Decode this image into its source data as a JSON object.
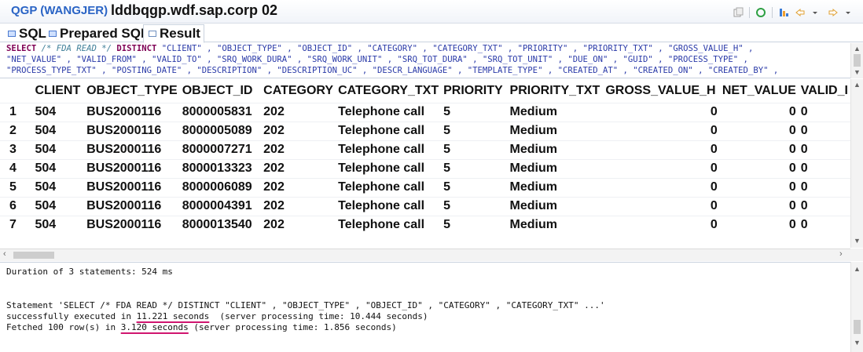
{
  "titlebar": {
    "connection": "QGP (WANGJER)",
    "host": "lddbqgp.wdf.sap.corp 02"
  },
  "tabs": [
    {
      "label": "SQL"
    },
    {
      "label": "Prepared SQL"
    },
    {
      "label": "Result"
    }
  ],
  "sql": {
    "line1_kw1": "SELECT",
    "line1_comment": "/* FDA READ */",
    "line1_kw2": "DISTINCT",
    "line1_rest": "\"CLIENT\" , \"OBJECT_TYPE\" , \"OBJECT_ID\" , \"CATEGORY\" , \"CATEGORY_TXT\" , \"PRIORITY\" , \"PRIORITY_TXT\" , \"GROSS_VALUE_H\" ,",
    "line2": "\"NET_VALUE\" , \"VALID_FROM\" , \"VALID_TO\" , \"SRQ_WORK_DURA\" , \"SRQ_WORK_UNIT\" , \"SRQ_TOT_DURA\" , \"SRQ_TOT_UNIT\" , \"DUE_ON\" , \"GUID\" , \"PROCESS_TYPE\" ,",
    "line3": "\"PROCESS_TYPE_TXT\" , \"POSTING_DATE\" , \"DESCRIPTION\" , \"DESCRIPTION_UC\" , \"DESCR_LANGUAGE\" , \"TEMPLATE_TYPE\" , \"CREATED_AT\" , \"CREATED_ON\" , \"CREATED_BY\" ,"
  },
  "grid": {
    "columns": [
      "",
      "CLIENT",
      "OBJECT_TYPE",
      "OBJECT_ID",
      "CATEGORY",
      "CATEGORY_TXT",
      "PRIORITY",
      "PRIORITY_TXT",
      "GROSS_VALUE_H",
      "NET_VALUE",
      "VALID_I"
    ],
    "rows": [
      [
        "1",
        "504",
        "BUS2000116",
        "8000005831",
        "202",
        "Telephone call",
        "5",
        "Medium",
        "0",
        "0",
        "0"
      ],
      [
        "2",
        "504",
        "BUS2000116",
        "8000005089",
        "202",
        "Telephone call",
        "5",
        "Medium",
        "0",
        "0",
        "0"
      ],
      [
        "3",
        "504",
        "BUS2000116",
        "8000007271",
        "202",
        "Telephone call",
        "5",
        "Medium",
        "0",
        "0",
        "0"
      ],
      [
        "4",
        "504",
        "BUS2000116",
        "8000013323",
        "202",
        "Telephone call",
        "5",
        "Medium",
        "0",
        "0",
        "0"
      ],
      [
        "5",
        "504",
        "BUS2000116",
        "8000006089",
        "202",
        "Telephone call",
        "5",
        "Medium",
        "0",
        "0",
        "0"
      ],
      [
        "6",
        "504",
        "BUS2000116",
        "8000004391",
        "202",
        "Telephone call",
        "5",
        "Medium",
        "0",
        "0",
        "0"
      ],
      [
        "7",
        "504",
        "BUS2000116",
        "8000013540",
        "202",
        "Telephone call",
        "5",
        "Medium",
        "0",
        "0",
        "0"
      ]
    ]
  },
  "console": {
    "duration": "Duration of 3 statements: 524 ms",
    "statement": "Statement 'SELECT /* FDA READ */ DISTINCT \"CLIENT\" , \"OBJECT_TYPE\" , \"OBJECT_ID\" , \"CATEGORY\" , \"CATEGORY_TXT\" ...'",
    "exec_prefix": "successfully executed in ",
    "exec_time": "11.221 seconds",
    "exec_suffix": "  (server processing time: 10.444 seconds)",
    "fetch_prefix": "Fetched 100 row(s) in ",
    "fetch_time": "3.120 seconds",
    "fetch_suffix": " (server processing time: 1.856 seconds)"
  },
  "colors": {
    "accent": "#2a64c5",
    "underline": "#d0156f",
    "keyword": "#7f0055"
  }
}
